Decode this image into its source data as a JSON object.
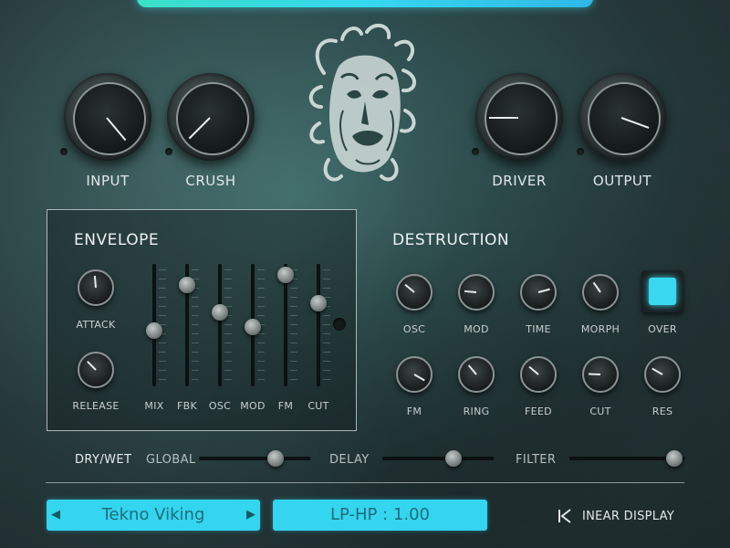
{
  "theme": {
    "accent": "#33d5ef",
    "panel_border": "#aeb5b5"
  },
  "main_knobs": [
    {
      "label": "INPUT",
      "icon": "knob"
    },
    {
      "label": "CRUSH",
      "icon": "knob"
    },
    {
      "label": "DRIVER",
      "icon": "knob"
    },
    {
      "label": "OUTPUT",
      "icon": "knob"
    }
  ],
  "emblem": {
    "icon": "medusa-head-emblem"
  },
  "envelope": {
    "title": "ENVELOPE",
    "knobs": [
      {
        "label": "ATTACK"
      },
      {
        "label": "RELEASE"
      }
    ],
    "sliders": [
      {
        "label": "MIX",
        "value": 0.45
      },
      {
        "label": "FBK",
        "value": 0.88
      },
      {
        "label": "OSC",
        "value": 0.62
      },
      {
        "label": "MOD",
        "value": 0.48
      },
      {
        "label": "FM",
        "value": 0.97
      },
      {
        "label": "CUT",
        "value": 0.71
      }
    ]
  },
  "destruction": {
    "title": "DESTRUCTION",
    "row1": [
      {
        "label": "OSC"
      },
      {
        "label": "MOD"
      },
      {
        "label": "TIME"
      },
      {
        "label": "MORPH"
      }
    ],
    "over_button": {
      "label": "OVER",
      "active": true
    },
    "row2": [
      {
        "label": "FM"
      },
      {
        "label": "RING"
      },
      {
        "label": "FEED"
      },
      {
        "label": "CUT"
      },
      {
        "label": "RES"
      }
    ]
  },
  "dry_wet": {
    "label": "DRY/WET",
    "sliders": [
      {
        "label": "GLOBAL",
        "value": 0.72
      },
      {
        "label": "DELAY",
        "value": 0.66
      },
      {
        "label": "FILTER",
        "value": 0.98
      }
    ]
  },
  "footer": {
    "preset_name": "Tekno Viking",
    "prev_arrow": "◀",
    "next_arrow": "▶",
    "readout": "LP-HP : 1.00",
    "display_toggle_label": "INEAR DISPLAY",
    "display_toggle_icon": "skip-back-icon"
  }
}
